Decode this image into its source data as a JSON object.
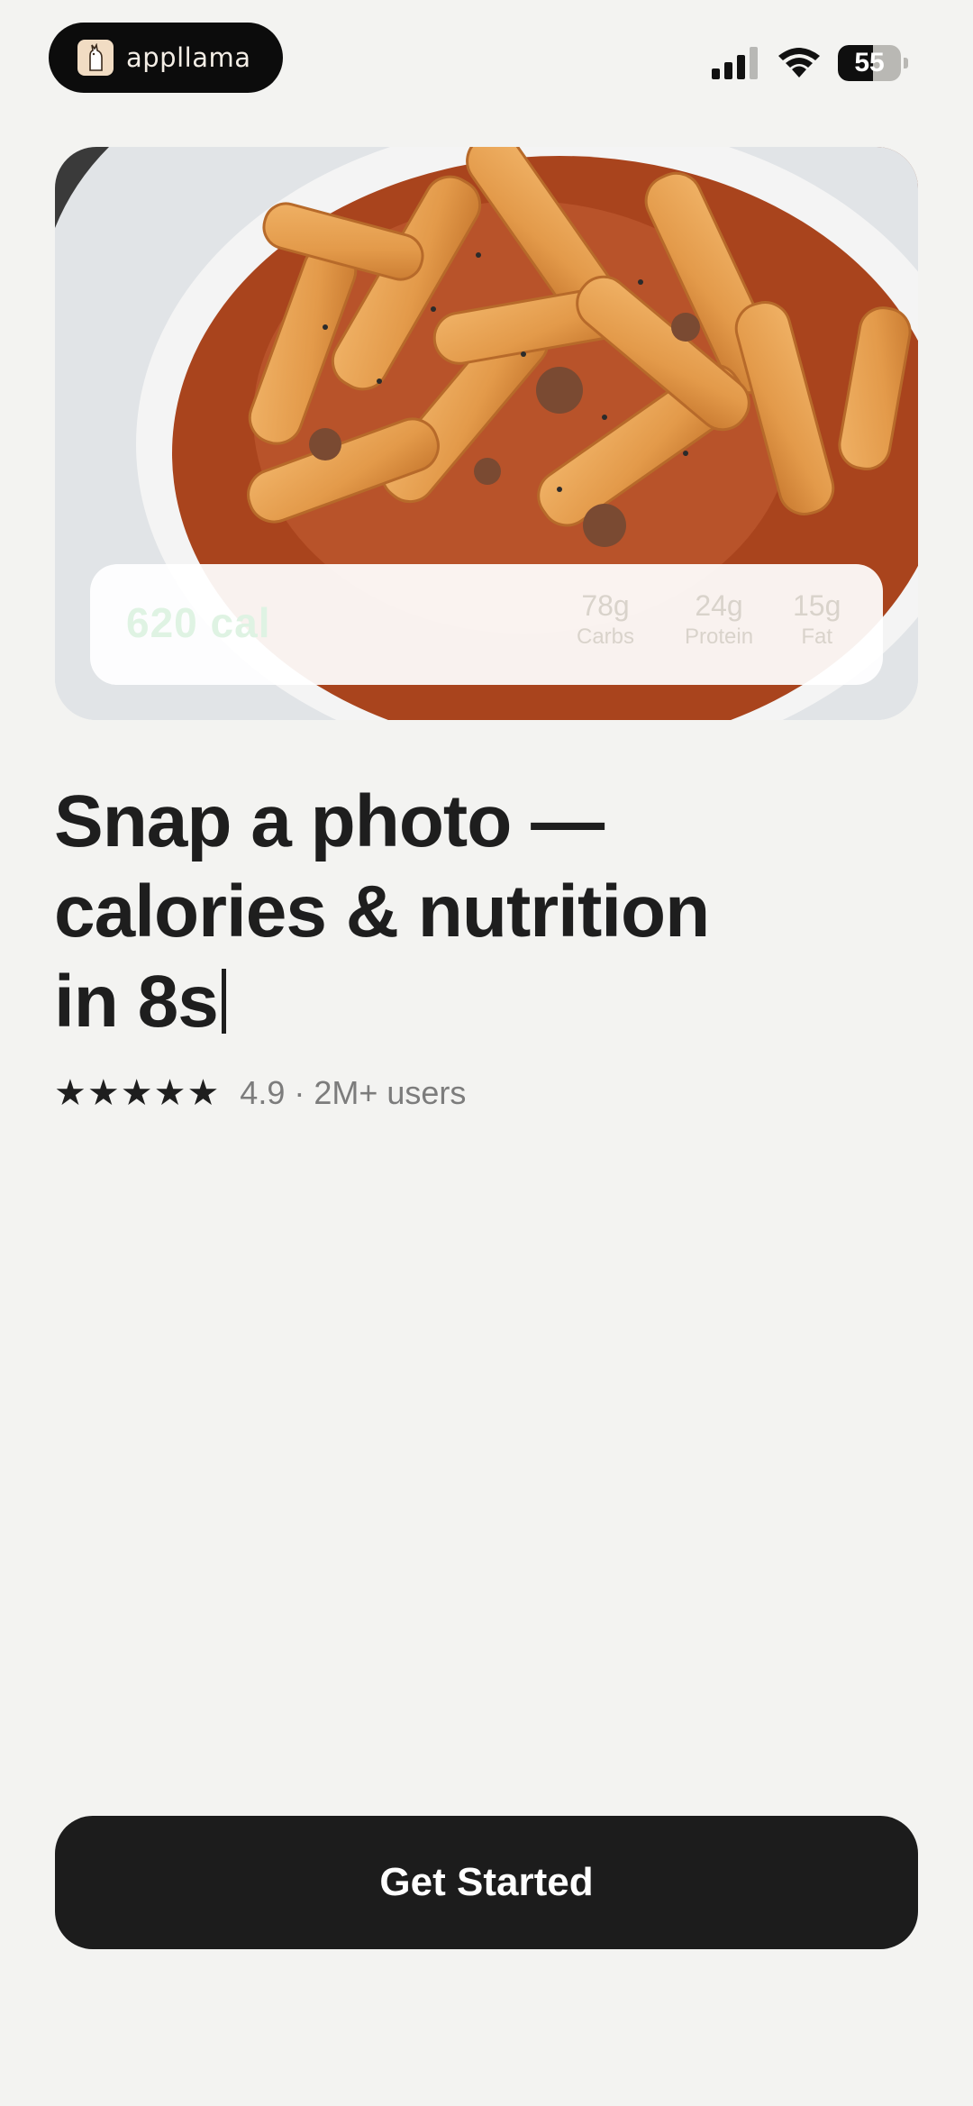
{
  "status_bar": {
    "brand_name": "appllama",
    "battery_percent": "55",
    "battery_level": 0.55
  },
  "hero": {
    "nutrition": {
      "calories": "620 cal",
      "macros": [
        {
          "value": "78g",
          "label": "Carbs"
        },
        {
          "value": "24g",
          "label": "Protein"
        },
        {
          "value": "15g",
          "label": "Fat"
        }
      ]
    }
  },
  "headline": {
    "lines": [
      "Snap a photo —",
      "calories & nutrition",
      "in 8s"
    ]
  },
  "rating": {
    "stars": "★★★★★",
    "text": "4.9 · 2M+ users"
  },
  "cta": {
    "label": "Get Started"
  }
}
